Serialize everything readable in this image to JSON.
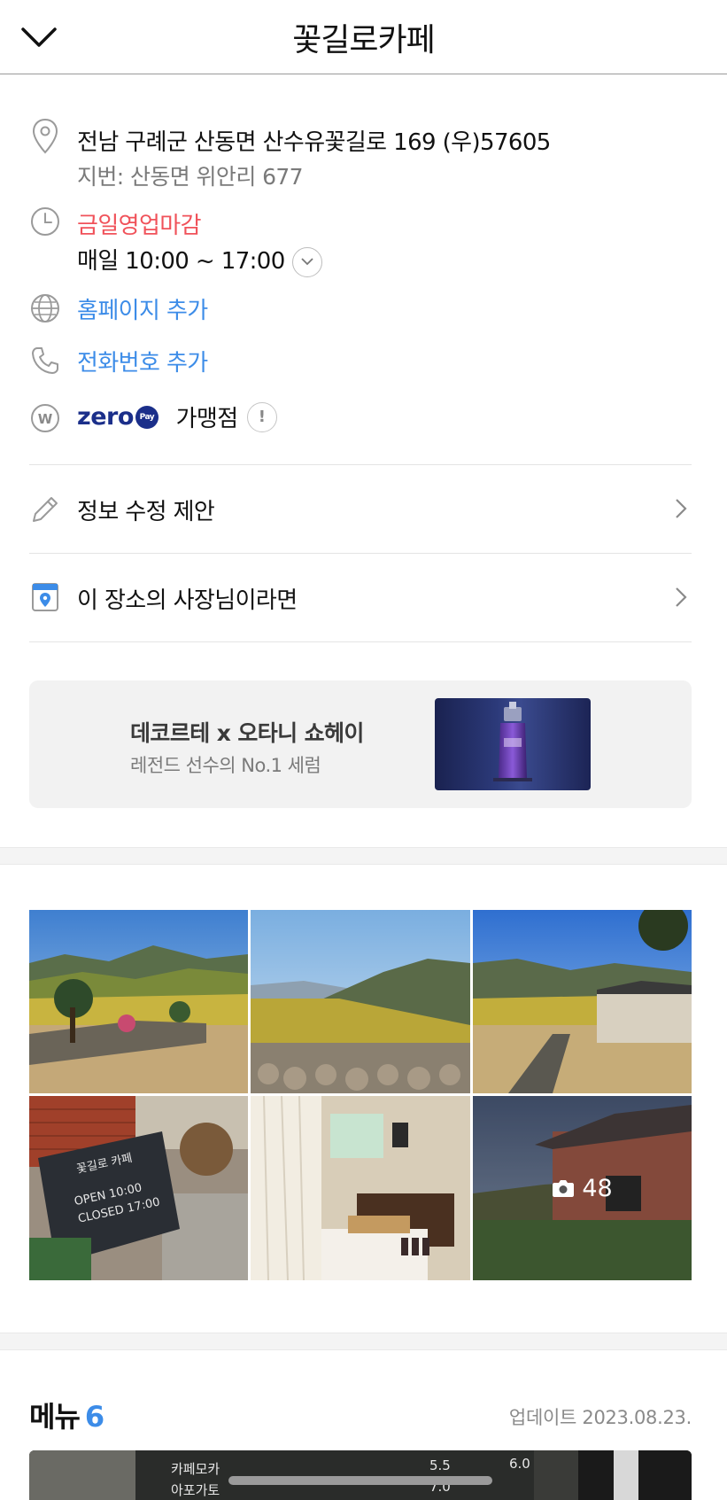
{
  "header": {
    "title": "꽃길로카페"
  },
  "address": {
    "main": "전남 구례군 산동면 산수유꽃길로 169 (우)57605",
    "lot": "지번: 산동면 위안리 677"
  },
  "hours": {
    "status": "금일영업마감",
    "schedule": "매일 10:00 ~ 17:00"
  },
  "homepage": {
    "label": "홈페이지 추가"
  },
  "phone": {
    "label": "전화번호 추가"
  },
  "zeropay": {
    "brand": "zero",
    "pay": "Pay",
    "label": "가맹점"
  },
  "actions": {
    "suggest_edit": "정보 수정 제안",
    "owner": "이 장소의 사장님이라면"
  },
  "ad": {
    "title": "데코르테 x 오타니 쇼헤이",
    "subtitle": "레전드 선수의 No.1 세럼"
  },
  "photos": {
    "more_count": "48"
  },
  "menu": {
    "title": "메뉴",
    "count": "6",
    "updated": "업데이트 2023.08.23."
  },
  "menu_photo_text": [
    "카페모카",
    "아포가토",
    "5.5",
    "6.0",
    "7.0"
  ],
  "colors": {
    "status_closed": "#f0525a",
    "link_blue": "#3c8ce8",
    "zeropay_navy": "#1b2f8a"
  }
}
